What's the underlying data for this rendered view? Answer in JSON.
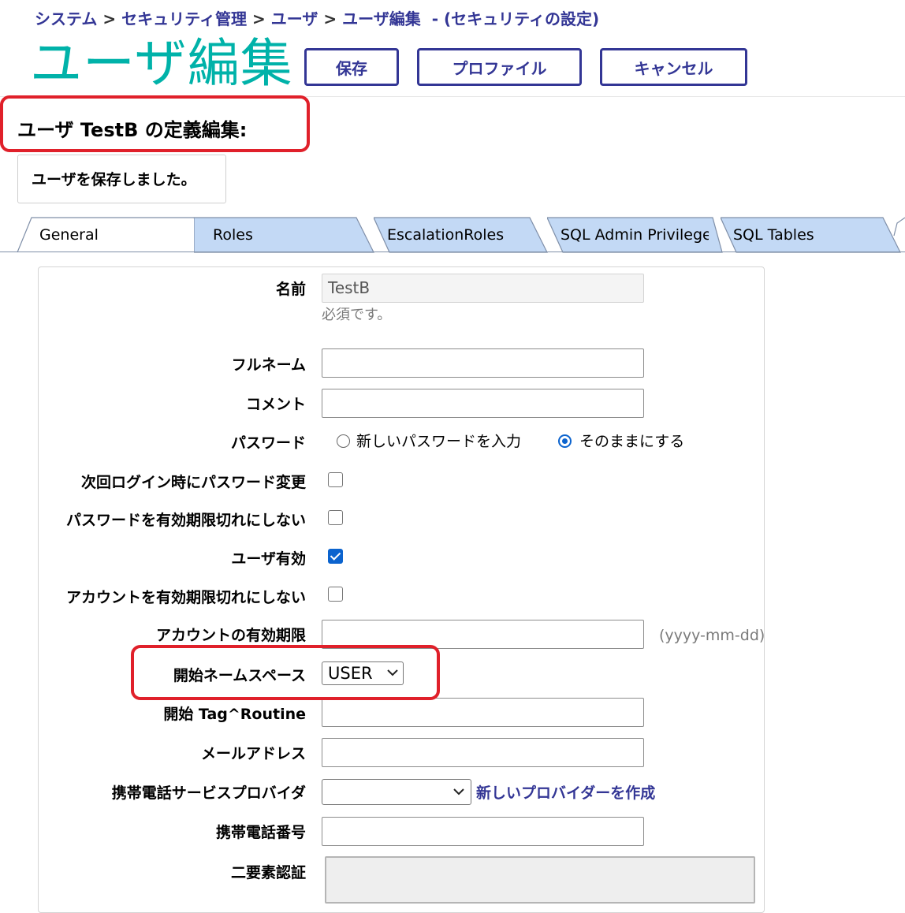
{
  "breadcrumb": {
    "items": [
      "システム",
      "セキュリティ管理",
      "ユーザ",
      "ユーザ編集"
    ],
    "separator": ">",
    "note": "- (セキュリティの設定)"
  },
  "page_title": "ユーザ編集",
  "toolbar": {
    "save_label": "保存",
    "profile_label": "プロファイル",
    "cancel_label": "キャンセル"
  },
  "subtitle": "ユーザ TestB の定義編集:",
  "message": "ユーザを保存しました。",
  "tabs": [
    {
      "label": "General",
      "active": true
    },
    {
      "label": "Roles",
      "active": false
    },
    {
      "label": "EscalationRoles",
      "active": false
    },
    {
      "label": "SQL Admin Privilege",
      "active": false
    },
    {
      "label": "SQL Tables",
      "active": false
    }
  ],
  "form": {
    "name": {
      "label": "名前",
      "value": "TestB",
      "hint": "必須です。"
    },
    "full_name": {
      "label": "フルネーム",
      "value": ""
    },
    "comment": {
      "label": "コメント",
      "value": ""
    },
    "password": {
      "label": "パスワード",
      "option_new": "新しいパスワードを入力",
      "option_keep": "そのままにする",
      "selected": "keep"
    },
    "change_password_next_login": {
      "label": "次回ログイン時にパスワード変更",
      "checked": false
    },
    "password_never_expires": {
      "label": "パスワードを有効期限切れにしない",
      "checked": false
    },
    "user_enabled": {
      "label": "ユーザ有効",
      "checked": true
    },
    "account_never_expires": {
      "label": "アカウントを有効期限切れにしない",
      "checked": false
    },
    "account_expiration": {
      "label": "アカウントの有効期限",
      "value": "",
      "format_hint": "(yyyy-mm-dd)"
    },
    "start_namespace": {
      "label": "開始ネームスペース",
      "value": "USER"
    },
    "start_routine": {
      "label": "開始 Tag^Routine",
      "value": ""
    },
    "email": {
      "label": "メールアドレス",
      "value": ""
    },
    "mobile_carrier": {
      "label": "携帯電話サービスプロバイダ",
      "value": "",
      "create_link": "新しいプロバイダーを作成"
    },
    "mobile_number": {
      "label": "携帯電話番号",
      "value": ""
    },
    "two_factor": {
      "label": "二要素認証"
    }
  },
  "colors": {
    "brand_teal": "#00b2a9",
    "brand_navy": "#333695",
    "tab_blue": "#c3d9f5",
    "highlight_red": "#e0202a",
    "check_blue": "#0b63ce"
  }
}
